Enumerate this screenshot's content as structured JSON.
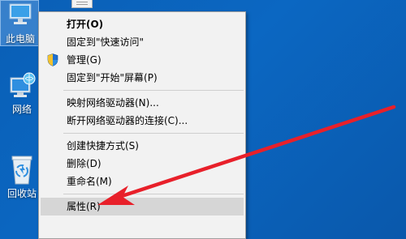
{
  "desktop": {
    "icons": [
      {
        "label": "此电脑"
      },
      {
        "label": "网络"
      },
      {
        "label": "回收站"
      }
    ]
  },
  "context_menu": {
    "items": [
      {
        "label": "打开(O)",
        "bold": true
      },
      {
        "label": "固定到\"快速访问\""
      },
      {
        "label": "管理(G)",
        "icon": "uac-shield-icon"
      },
      {
        "label": "固定到\"开始\"屏幕(P)"
      },
      {
        "label": "映射网络驱动器(N)..."
      },
      {
        "label": "断开网络驱动器的连接(C)..."
      },
      {
        "label": "创建快捷方式(S)"
      },
      {
        "label": "删除(D)"
      },
      {
        "label": "重命名(M)"
      },
      {
        "label": "属性(R)",
        "highlighted": true
      }
    ]
  },
  "annotation": {
    "arrow_color": "#e8202a",
    "points_to": "属性(R)"
  },
  "colors": {
    "desktop_background": "#0b67c2",
    "menu_background": "#f2f2f2",
    "menu_highlight": "#d6d6d6"
  }
}
